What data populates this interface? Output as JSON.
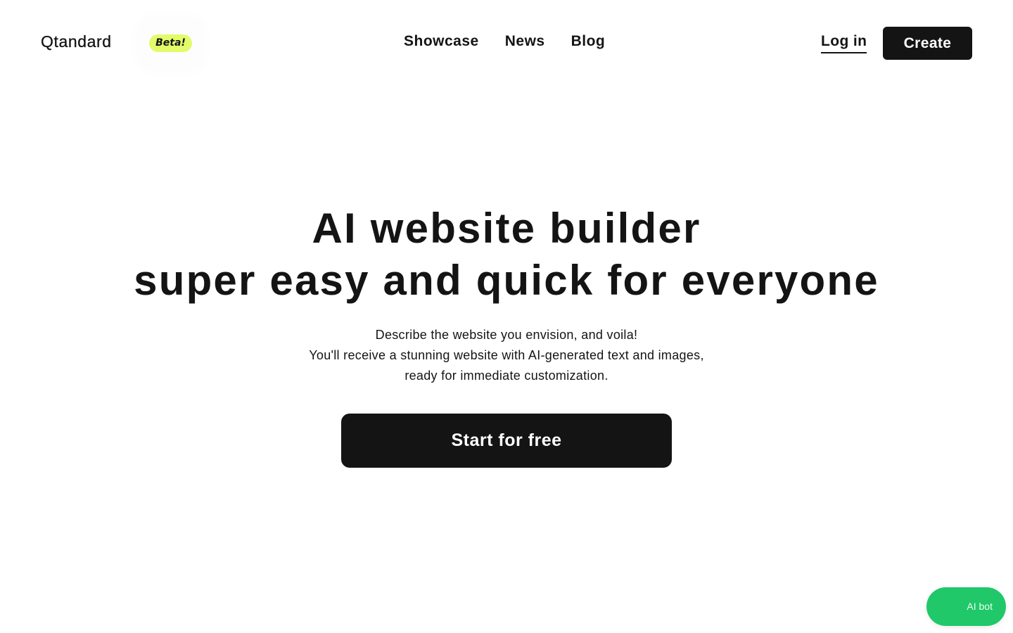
{
  "header": {
    "logo": "Qtandard",
    "badge": "Beta!",
    "nav": [
      {
        "label": "Showcase"
      },
      {
        "label": "News"
      },
      {
        "label": "Blog"
      }
    ],
    "login_label": "Log in",
    "create_label": "Create"
  },
  "hero": {
    "title_line1": "AI website builder",
    "title_line2": "super easy and quick for everyone",
    "subtitle_line1": "Describe the website you envision, and voila!",
    "subtitle_line2": "You'll receive a stunning website with AI-generated text and images,",
    "subtitle_line3": "ready for immediate customization.",
    "cta_label": "Start for free"
  },
  "chat_widget": {
    "label": "AI bot",
    "color": "#20c86a"
  },
  "colors": {
    "primary": "#141414",
    "badge": "#e2fb6b",
    "background": "#ffffff"
  }
}
